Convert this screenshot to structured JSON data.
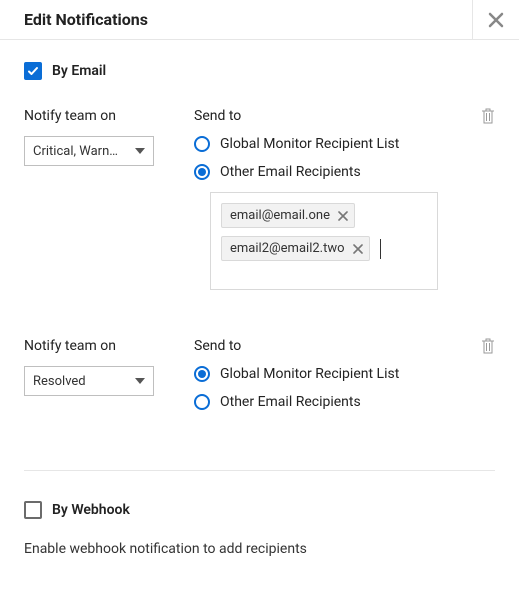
{
  "header": {
    "title": "Edit Notifications"
  },
  "byEmail": {
    "label": "By Email",
    "checked": true
  },
  "section1": {
    "notifyLabel": "Notify team on",
    "selectValue": "Critical, Warn…",
    "sendToLabel": "Send to",
    "option1": {
      "label": "Global Monitor Recipient List",
      "selected": false
    },
    "option2": {
      "label": "Other Email Recipients",
      "selected": true
    },
    "emails": [
      "email@email.one",
      "email2@email2.two"
    ]
  },
  "section2": {
    "notifyLabel": "Notify team on",
    "selectValue": "Resolved",
    "sendToLabel": "Send to",
    "option1": {
      "label": "Global Monitor Recipient List",
      "selected": true
    },
    "option2": {
      "label": "Other Email Recipients",
      "selected": false
    }
  },
  "byWebhook": {
    "label": "By Webhook",
    "checked": false,
    "hint": "Enable webhook notification to add recipients"
  }
}
